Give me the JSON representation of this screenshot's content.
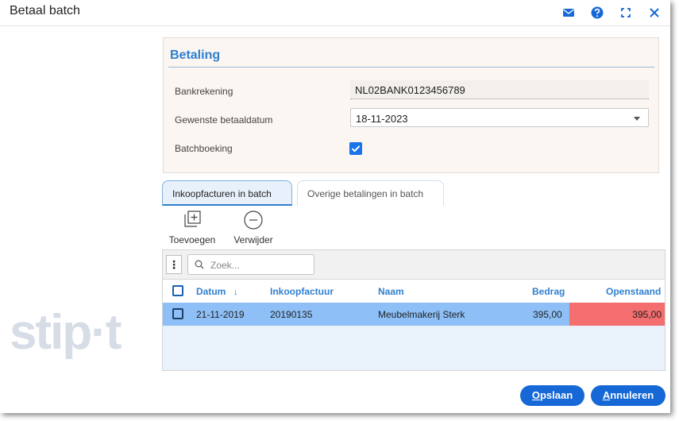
{
  "window": {
    "title": "Betaal batch",
    "icons": [
      "mail-icon",
      "help-icon",
      "fullscreen-icon",
      "close-icon"
    ]
  },
  "branding": {
    "logo_text": "stip·t"
  },
  "betaling": {
    "title": "Betaling",
    "bankrekening_label": "Bankrekening",
    "bankrekening_value": "NL02BANK0123456789",
    "betaaldatum_label": "Gewenste betaaldatum",
    "betaaldatum_value": "18-11-2023",
    "batchboeking_label": "Batchboeking",
    "batchboeking_checked": true
  },
  "tabs": [
    {
      "label": "Inkoopfacturen in batch",
      "active": true
    },
    {
      "label": "Overige betalingen in batch",
      "active": false
    }
  ],
  "toolbar": {
    "add_label": "Toevoegen",
    "remove_label": "Verwijder"
  },
  "grid": {
    "search_placeholder": "Zoek...",
    "menu_glyph": "⋮",
    "columns": {
      "datum": "Datum",
      "sort_indicator": "↓",
      "inkoopfactuur": "Inkoopfactuur",
      "naam": "Naam",
      "bedrag": "Bedrag",
      "openstaand": "Openstaand"
    },
    "rows": [
      {
        "datum": "21-11-2019",
        "inkoopfactuur": "20190135",
        "naam": "Meubelmakerij Sterk",
        "bedrag": "395,00",
        "openstaand": "395,00"
      }
    ]
  },
  "buttons": {
    "save_first": "O",
    "save_rest": "pslaan",
    "cancel_first": "A",
    "cancel_rest": "nnuleren"
  },
  "colors": {
    "accent": "#1668d6",
    "heading_blue": "#2f7fd0",
    "row_selected": "#8ec0f7",
    "outstanding_red": "#f46d6f",
    "panel_bg": "#fbf6f1"
  }
}
